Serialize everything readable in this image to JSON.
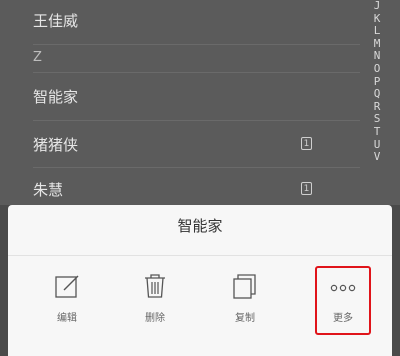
{
  "contacts": {
    "rows": [
      {
        "name": "王佳威"
      },
      {
        "section": "Z"
      },
      {
        "name": "智能家"
      },
      {
        "name": "猪猪侠",
        "badge": "1"
      },
      {
        "name": "朱慧",
        "badge": "1"
      }
    ]
  },
  "index_bar": [
    "J",
    "K",
    "L",
    "M",
    "N",
    "O",
    "P",
    "Q",
    "R",
    "S",
    "T",
    "U",
    "V"
  ],
  "sheet": {
    "title": "智能家",
    "actions": [
      {
        "label": "编辑",
        "icon": "edit-icon"
      },
      {
        "label": "删除",
        "icon": "trash-icon"
      },
      {
        "label": "复制",
        "icon": "copy-icon"
      },
      {
        "label": "更多",
        "icon": "more-dots-icon",
        "highlighted": true
      }
    ]
  },
  "colors": {
    "highlight": "#e0141a",
    "sheet_bg": "#f7f7f7",
    "overlay_bg": "#5b5b5b"
  }
}
